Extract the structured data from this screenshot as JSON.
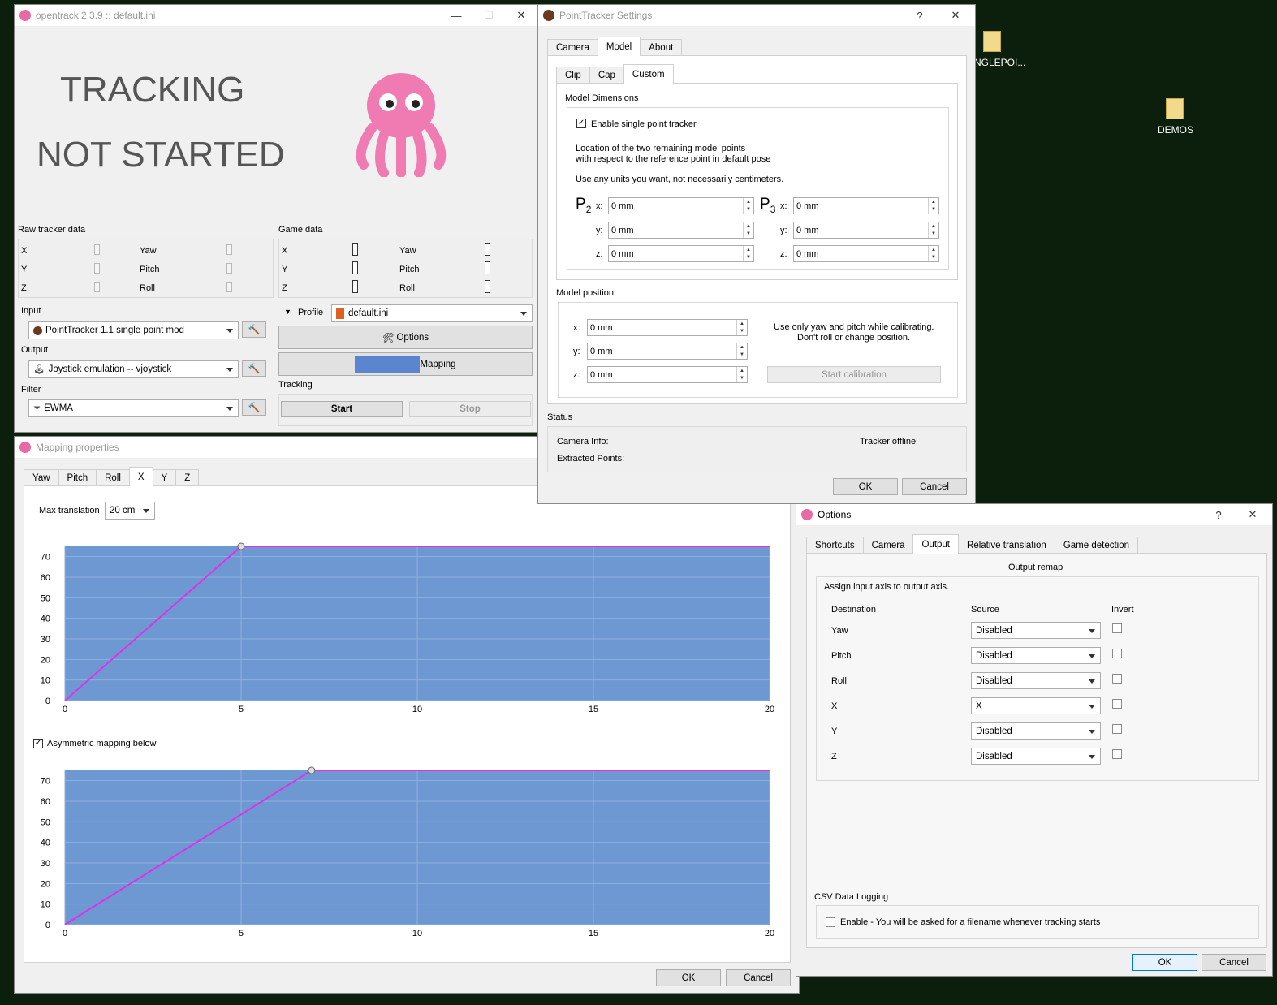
{
  "desktop": {
    "icon1_label": "NGLEPOI...",
    "icon2_label": "DEMOS"
  },
  "main": {
    "title": "opentrack 2.3.9 :: default.ini",
    "status_line1": "TRACKING",
    "status_line2": "NOT STARTED",
    "raw_label": "Raw tracker data",
    "game_label": "Game data",
    "axes": {
      "x": "X",
      "y": "Y",
      "z": "Z",
      "yaw": "Yaw",
      "pitch": "Pitch",
      "roll": "Roll"
    },
    "input_label": "Input",
    "input_value": "PointTracker 1.1 single point mod",
    "output_label": "Output",
    "output_value": "Joystick emulation -- vjoystick",
    "filter_label": "Filter",
    "filter_value": "EWMA",
    "profile_label": "Profile",
    "profile_value": "default.ini",
    "options_label": "Options",
    "mapping_label": "Mapping",
    "tracking_label": "Tracking",
    "start_label": "Start",
    "stop_label": "Stop"
  },
  "pt": {
    "title": "PointTracker Settings",
    "help": "?",
    "tabs": [
      "Camera",
      "Model",
      "About"
    ],
    "subtabs": [
      "Clip",
      "Cap",
      "Custom"
    ],
    "model_dims": "Model Dimensions",
    "enable_single": "Enable single point tracker",
    "loc1": "Location of the two remaining model points",
    "loc2": "with respect to the reference point in default pose",
    "units": "Use any units you want, not necessarily centimeters.",
    "p2": "P",
    "p2sub": "2",
    "p3": "P",
    "p3sub": "3",
    "x": "x:",
    "y": "y:",
    "z": "z:",
    "mm": "0 mm",
    "model_pos": "Model position",
    "calib1": "Use only yaw and pitch while calibrating.",
    "calib2": "Don't roll or change position.",
    "start_calib": "Start calibration",
    "status": "Status",
    "camera_info": "Camera Info:",
    "tracker_offline": "Tracker offline",
    "extracted": "Extracted Points:",
    "ok": "OK",
    "cancel": "Cancel"
  },
  "mapping": {
    "title": "Mapping properties",
    "tabs": [
      "Yaw",
      "Pitch",
      "Roll",
      "X",
      "Y",
      "Z"
    ],
    "max_translation_label": "Max translation",
    "max_translation_value": "20 cm",
    "asym_label": "Asymmetric mapping below",
    "ok": "OK",
    "cancel": "Cancel"
  },
  "chart_data": [
    {
      "type": "line",
      "x_ticks": [
        0,
        5,
        10,
        15,
        20
      ],
      "y_ticks": [
        0,
        10,
        20,
        30,
        40,
        50,
        60,
        70
      ],
      "xlim": [
        0,
        20
      ],
      "ylim": [
        0,
        75
      ],
      "series": [
        {
          "points": [
            [
              0,
              0
            ],
            [
              5,
              75
            ],
            [
              20,
              75
            ]
          ]
        }
      ],
      "control_points": [
        [
          5,
          75
        ]
      ],
      "grid": true,
      "colors": {
        "fill": "#6d98d2",
        "line": "#e030e8"
      }
    },
    {
      "type": "line",
      "x_ticks": [
        0,
        5,
        10,
        15,
        20
      ],
      "y_ticks": [
        0,
        10,
        20,
        30,
        40,
        50,
        60,
        70
      ],
      "xlim": [
        0,
        20
      ],
      "ylim": [
        0,
        75
      ],
      "series": [
        {
          "points": [
            [
              0,
              0
            ],
            [
              7,
              75
            ],
            [
              20,
              75
            ]
          ]
        }
      ],
      "control_points": [
        [
          7,
          75
        ]
      ],
      "grid": true,
      "colors": {
        "fill": "#6d98d2",
        "line": "#e030e8"
      }
    }
  ],
  "options": {
    "title": "Options",
    "help": "?",
    "tabs": [
      "Shortcuts",
      "Camera",
      "Output",
      "Relative translation",
      "Game detection"
    ],
    "output_remap": "Output remap",
    "assign": "Assign input axis to output axis.",
    "destination": "Destination",
    "source": "Source",
    "invert": "Invert",
    "rows": [
      {
        "dest": "Yaw",
        "source": "Disabled"
      },
      {
        "dest": "Pitch",
        "source": "Disabled"
      },
      {
        "dest": "Roll",
        "source": "Disabled"
      },
      {
        "dest": "X",
        "source": "X"
      },
      {
        "dest": "Y",
        "source": "Disabled"
      },
      {
        "dest": "Z",
        "source": "Disabled"
      }
    ],
    "csv_label": "CSV Data Logging",
    "csv_enable": "Enable - You will be asked for a filename whenever tracking starts",
    "ok": "OK",
    "cancel": "Cancel"
  }
}
